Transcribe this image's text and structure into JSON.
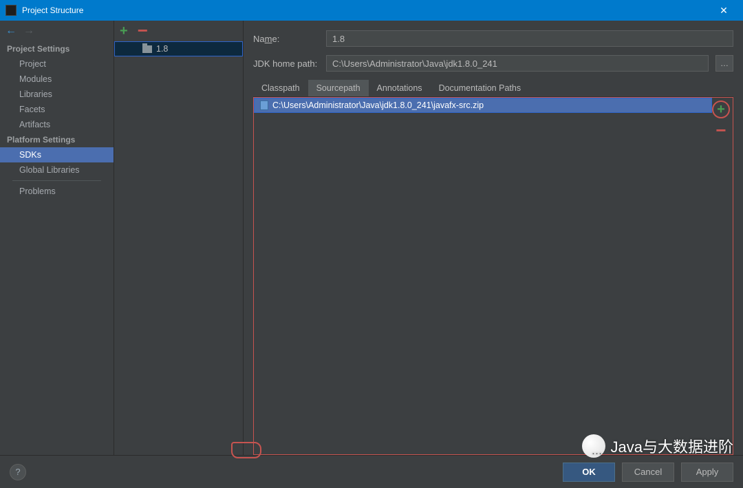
{
  "window": {
    "title": "Project Structure"
  },
  "sidebar": {
    "sections": [
      {
        "header": "Project Settings",
        "items": [
          "Project",
          "Modules",
          "Libraries",
          "Facets",
          "Artifacts"
        ]
      },
      {
        "header": "Platform Settings",
        "items": [
          "SDKs",
          "Global Libraries"
        ]
      },
      {
        "header": "",
        "items": [
          "Problems"
        ]
      }
    ],
    "selected": "SDKs"
  },
  "sdklist": {
    "items": [
      "1.8"
    ],
    "selected": "1.8"
  },
  "detail": {
    "name_label": "Name:",
    "name_value": "1.8",
    "home_label": "JDK home path:",
    "home_value": "C:\\Users\\Administrator\\Java\\jdk1.8.0_241",
    "tabs": [
      "Classpath",
      "Sourcepath",
      "Annotations",
      "Documentation Paths"
    ],
    "selected_tab": "Sourcepath",
    "paths": [
      "C:\\Users\\Administrator\\Java\\jdk1.8.0_241\\javafx-src.zip"
    ]
  },
  "buttons": {
    "ok": "OK",
    "cancel": "Cancel",
    "apply": "Apply"
  },
  "watermark": "Java与大数据进阶"
}
